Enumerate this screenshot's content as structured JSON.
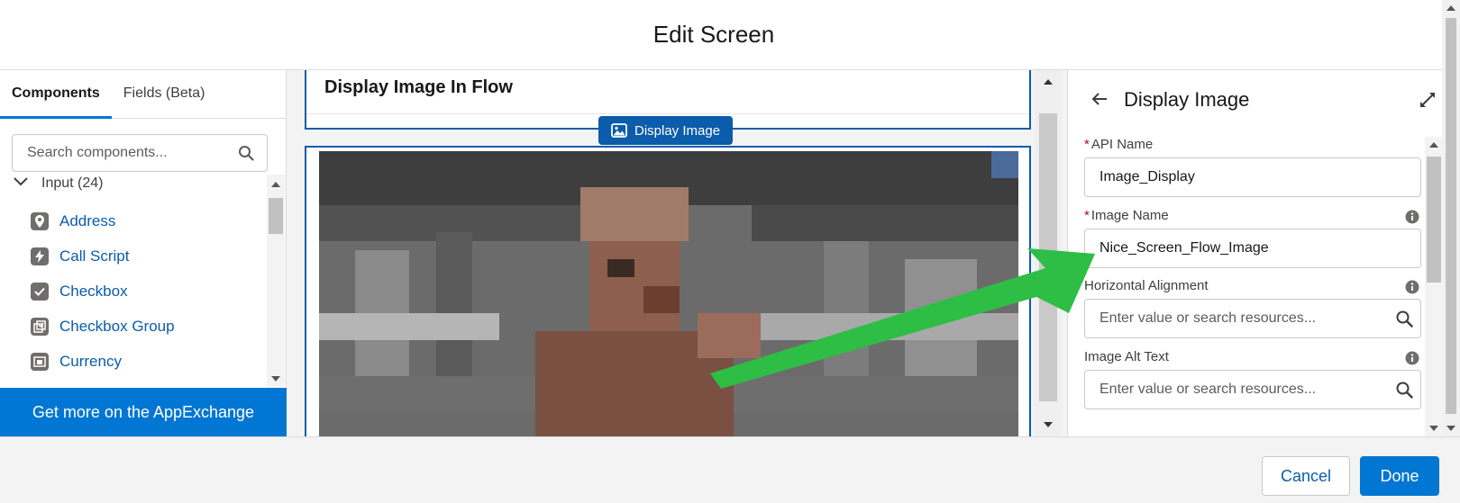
{
  "header": {
    "title": "Edit Screen"
  },
  "left_panel": {
    "tabs": [
      {
        "label": "Components",
        "active": true
      },
      {
        "label": "Fields (Beta)",
        "active": false
      }
    ],
    "search": {
      "placeholder": "Search components..."
    },
    "group": {
      "label": "Input (24)"
    },
    "items": [
      {
        "label": "Address",
        "icon": "location-pin-icon"
      },
      {
        "label": "Call Script",
        "icon": "lightning-icon"
      },
      {
        "label": "Checkbox",
        "icon": "checkbox-icon"
      },
      {
        "label": "Checkbox Group",
        "icon": "checkbox-group-icon"
      },
      {
        "label": "Currency",
        "icon": "currency-icon"
      }
    ],
    "appexchange_label": "Get more on the AppExchange"
  },
  "canvas": {
    "section_title": "Display Image In Flow",
    "selected_component_label": "Display Image"
  },
  "properties": {
    "title": "Display Image",
    "fields": [
      {
        "label": "API Name",
        "required": true,
        "value": "Image_Display",
        "info": false
      },
      {
        "label": "Image Name",
        "required": true,
        "value": "Nice_Screen_Flow_Image",
        "info": true
      },
      {
        "label": "Horizontal Alignment",
        "required": false,
        "placeholder": "Enter value or search resources...",
        "info": true
      },
      {
        "label": "Image Alt Text",
        "required": false,
        "placeholder": "Enter value or search resources...",
        "info": true
      }
    ]
  },
  "footer": {
    "cancel_label": "Cancel",
    "done_label": "Done"
  },
  "colors": {
    "brand": "#0176d3",
    "selection": "#0b5cab",
    "annotation_arrow": "#2ebd45"
  }
}
